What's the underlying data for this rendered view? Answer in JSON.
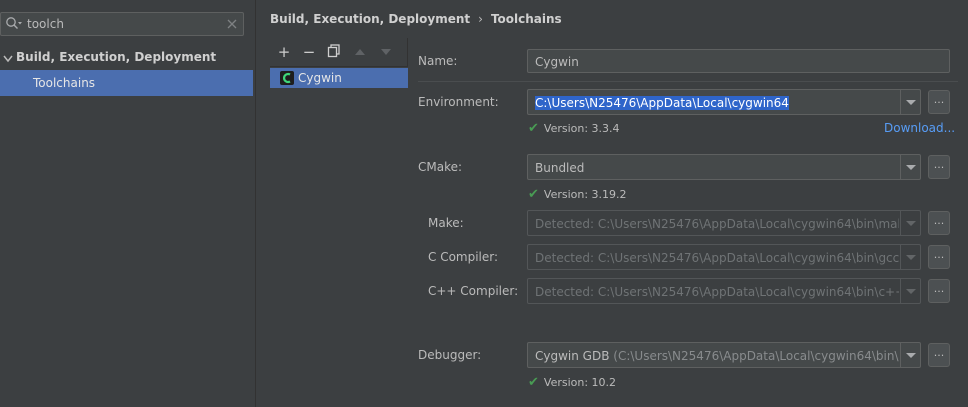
{
  "search": {
    "value": "toolch"
  },
  "tree": {
    "parent_label": "Build, Execution, Deployment",
    "child_label": "Toolchains"
  },
  "breadcrumb": {
    "part1": "Build, Execution, Deployment",
    "separator": "›",
    "part2": "Toolchains"
  },
  "toolbar": {
    "add": "+",
    "remove": "−",
    "copy": "copy",
    "up": "up",
    "down": "down"
  },
  "toolchains": {
    "items": [
      {
        "label": "Cygwin"
      }
    ]
  },
  "form": {
    "name": {
      "label": "Name:",
      "value": "Cygwin"
    },
    "environment": {
      "label": "Environment:",
      "value": "C:\\Users\\N25476\\AppData\\Local\\cygwin64",
      "version": "Version: 3.3.4",
      "download": "Download..."
    },
    "cmake": {
      "label": "CMake:",
      "value": "Bundled",
      "version": "Version: 3.19.2"
    },
    "make": {
      "label": "Make:",
      "value": "Detected: C:\\Users\\N25476\\AppData\\Local\\cygwin64\\bin\\mak"
    },
    "c_compiler": {
      "label": "C Compiler:",
      "value": "Detected: C:\\Users\\N25476\\AppData\\Local\\cygwin64\\bin\\gcc."
    },
    "cpp_compiler": {
      "label": "C++ Compiler:",
      "value": "Detected: C:\\Users\\N25476\\AppData\\Local\\cygwin64\\bin\\c++"
    },
    "debugger": {
      "label": "Debugger:",
      "value": "Cygwin GDB",
      "path": "(C:\\Users\\N25476\\AppData\\Local\\cygwin64\\bin\\g",
      "version": "Version: 10.2"
    },
    "browse_label": "..."
  },
  "colors": {
    "background": "#3c3f41",
    "selection": "#4b6eaf",
    "text_highlight": "#2f65ca",
    "check": "#499c54",
    "link": "#589df6"
  }
}
